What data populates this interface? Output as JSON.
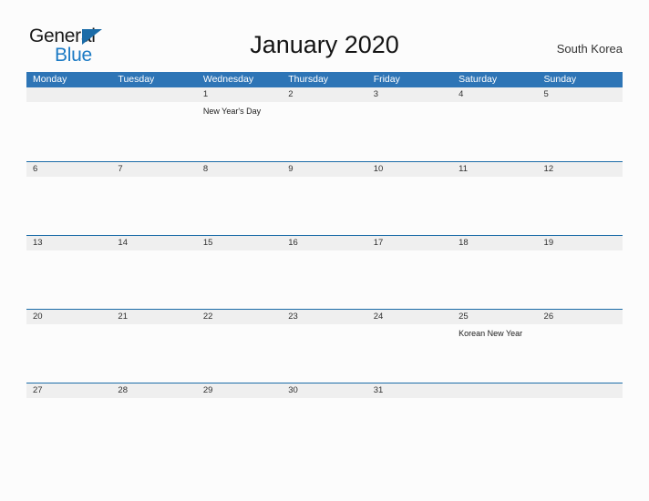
{
  "brand": {
    "name_part1": "General",
    "name_part2": "Blue",
    "triangle_color": "#1b6ca8",
    "blue_color": "#1b7ac4"
  },
  "header": {
    "title": "January 2020",
    "locale": "South Korea"
  },
  "calendar": {
    "accent_color": "#2e75b6",
    "row_line_color": "#1b6ca8",
    "number_band_color": "#efefef",
    "day_names": [
      "Monday",
      "Tuesday",
      "Wednesday",
      "Thursday",
      "Friday",
      "Saturday",
      "Sunday"
    ],
    "weeks": [
      {
        "days": [
          {
            "num": "",
            "event": ""
          },
          {
            "num": "",
            "event": ""
          },
          {
            "num": "1",
            "event": "New Year's Day"
          },
          {
            "num": "2",
            "event": ""
          },
          {
            "num": "3",
            "event": ""
          },
          {
            "num": "4",
            "event": ""
          },
          {
            "num": "5",
            "event": ""
          }
        ]
      },
      {
        "days": [
          {
            "num": "6",
            "event": ""
          },
          {
            "num": "7",
            "event": ""
          },
          {
            "num": "8",
            "event": ""
          },
          {
            "num": "9",
            "event": ""
          },
          {
            "num": "10",
            "event": ""
          },
          {
            "num": "11",
            "event": ""
          },
          {
            "num": "12",
            "event": ""
          }
        ]
      },
      {
        "days": [
          {
            "num": "13",
            "event": ""
          },
          {
            "num": "14",
            "event": ""
          },
          {
            "num": "15",
            "event": ""
          },
          {
            "num": "16",
            "event": ""
          },
          {
            "num": "17",
            "event": ""
          },
          {
            "num": "18",
            "event": ""
          },
          {
            "num": "19",
            "event": ""
          }
        ]
      },
      {
        "days": [
          {
            "num": "20",
            "event": ""
          },
          {
            "num": "21",
            "event": ""
          },
          {
            "num": "22",
            "event": ""
          },
          {
            "num": "23",
            "event": ""
          },
          {
            "num": "24",
            "event": ""
          },
          {
            "num": "25",
            "event": "Korean New Year"
          },
          {
            "num": "26",
            "event": ""
          }
        ]
      },
      {
        "days": [
          {
            "num": "27",
            "event": ""
          },
          {
            "num": "28",
            "event": ""
          },
          {
            "num": "29",
            "event": ""
          },
          {
            "num": "30",
            "event": ""
          },
          {
            "num": "31",
            "event": ""
          },
          {
            "num": "",
            "event": ""
          },
          {
            "num": "",
            "event": ""
          }
        ]
      }
    ]
  }
}
